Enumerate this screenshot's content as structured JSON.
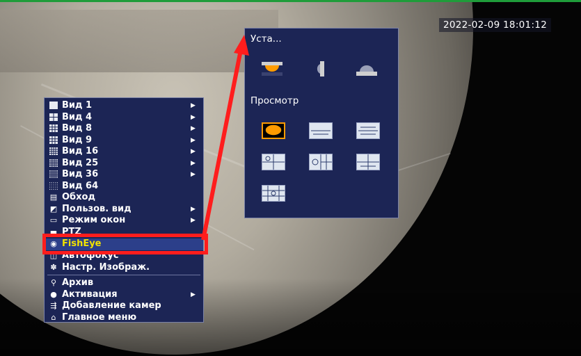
{
  "overlay": {
    "timestamp": "2022-02-09 18:01:12"
  },
  "context_menu": {
    "items": [
      {
        "label": "Вид 1",
        "icon": "view-1-icon",
        "submenu": true
      },
      {
        "label": "Вид 4",
        "icon": "view-4-icon",
        "submenu": true
      },
      {
        "label": "Вид 8",
        "icon": "view-8-icon",
        "submenu": true
      },
      {
        "label": "Вид 9",
        "icon": "view-9-icon",
        "submenu": true
      },
      {
        "label": "Вид 16",
        "icon": "view-16-icon",
        "submenu": true
      },
      {
        "label": "Вид 25",
        "icon": "view-25-icon",
        "submenu": true
      },
      {
        "label": "Вид 36",
        "icon": "view-36-icon",
        "submenu": true
      },
      {
        "label": "Вид 64",
        "icon": "view-64-icon",
        "submenu": false
      },
      {
        "label": "Обход",
        "icon": "tour-icon",
        "submenu": false
      },
      {
        "label": "Пользов. вид",
        "icon": "custom-view-icon",
        "submenu": true
      },
      {
        "label": "Режим окон",
        "icon": "window-mode-icon",
        "submenu": true
      },
      {
        "label": "PTZ",
        "icon": "ptz-icon",
        "submenu": false
      },
      {
        "label": "FishEye",
        "icon": "eye-icon",
        "submenu": false,
        "selected": true
      },
      {
        "label": "Автофокус",
        "icon": "autofocus-icon",
        "submenu": false
      },
      {
        "label": "Настр. Изображ.",
        "icon": "image-settings-icon",
        "submenu": false
      },
      {
        "label": "Архив",
        "icon": "search-icon",
        "submenu": false
      },
      {
        "label": "Активация",
        "icon": "activation-icon",
        "submenu": true
      },
      {
        "label": "Добавление камер",
        "icon": "add-camera-icon",
        "submenu": false
      },
      {
        "label": "Главное меню",
        "icon": "home-icon",
        "submenu": false
      }
    ]
  },
  "fisheye_panel": {
    "install_title": "Уста...",
    "install_modes": [
      "ceiling-mount-icon",
      "wall-mount-icon",
      "ground-mount-icon"
    ],
    "view_title": "Просмотр",
    "view_modes": [
      {
        "icon": "fisheye-original-icon",
        "selected": true
      },
      {
        "icon": "panorama-180-icon",
        "selected": false
      },
      {
        "icon": "panorama-360-split-icon",
        "selected": false
      },
      {
        "icon": "fisheye-1p1-icon",
        "selected": false
      },
      {
        "icon": "fisheye-1p3-icon",
        "selected": false
      },
      {
        "icon": "fisheye-panorama-4-icon",
        "selected": false
      },
      {
        "icon": "fisheye-1p8-icon",
        "selected": false
      }
    ]
  },
  "colors": {
    "menu_bg": "#1c2555",
    "highlight": "#ff1d1d",
    "selected_text": "#f2e200",
    "selected_tile": "#ff9b00"
  }
}
